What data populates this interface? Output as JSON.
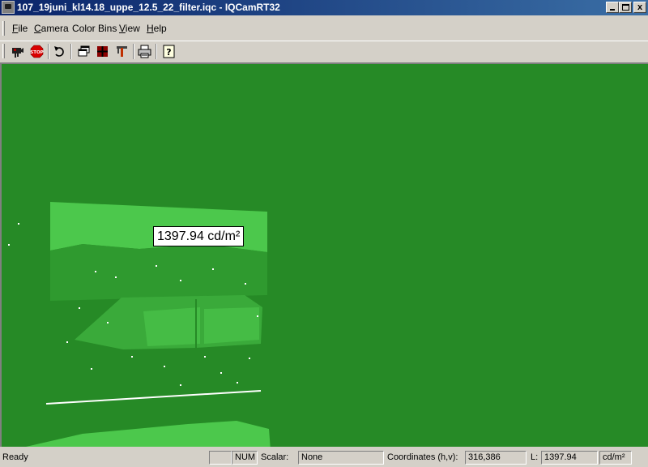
{
  "window": {
    "title": "107_19juni_kl14.18_uppe_12.5_22_filter.iqc - IQCamRT32",
    "minimize_label": "",
    "maximize_label": "",
    "close_label": "x"
  },
  "menu": {
    "items": [
      {
        "label": "File",
        "accel": "F",
        "rest": "ile"
      },
      {
        "label": "Camera",
        "accel": "C",
        "rest": "amera"
      },
      {
        "label": "Color Bins",
        "accel": "",
        "rest": "Color Bins"
      },
      {
        "label": "View",
        "accel": "V",
        "rest": "iew"
      },
      {
        "label": "Help",
        "accel": "H",
        "rest": "elp"
      }
    ]
  },
  "toolbar": {
    "buttons": [
      {
        "icon": "camera-icon"
      },
      {
        "icon": "stop-icon"
      },
      {
        "icon": "undo-arrow-icon"
      },
      {
        "icon": "windows-icon"
      },
      {
        "icon": "grid-icon"
      },
      {
        "icon": "tools-icon"
      },
      {
        "icon": "printer-icon"
      },
      {
        "icon": "help-icon"
      }
    ]
  },
  "image_view": {
    "tooltip": "1397.94 cd/m²",
    "colors": {
      "background": "#268a26",
      "mid": "#3aaa3a",
      "bright": "#4cc84c",
      "highlight": "#ffffff"
    }
  },
  "statusbar": {
    "ready": "Ready",
    "num": "NUM",
    "scalar_label": "Scalar:",
    "scalar_value": "None",
    "coords_label": "Coordinates (h,v):",
    "coords_value": "316,386",
    "l_label": "L:",
    "l_value": "1397.94",
    "unit": "cd/m²"
  }
}
